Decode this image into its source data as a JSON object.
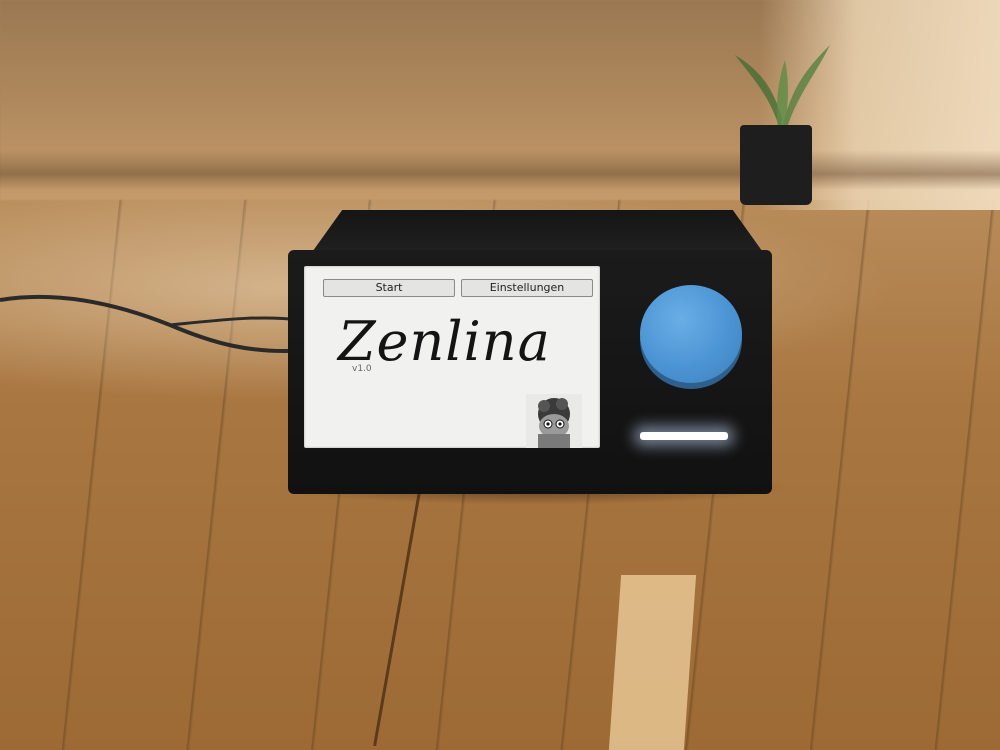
{
  "device": {
    "screen": {
      "tabs": [
        {
          "label": "Start"
        },
        {
          "label": "Einstellungen"
        }
      ],
      "title": "Zenlina",
      "version": "v1.0"
    },
    "knob_color": "#4b94d3",
    "led_color": "#ffffff"
  }
}
